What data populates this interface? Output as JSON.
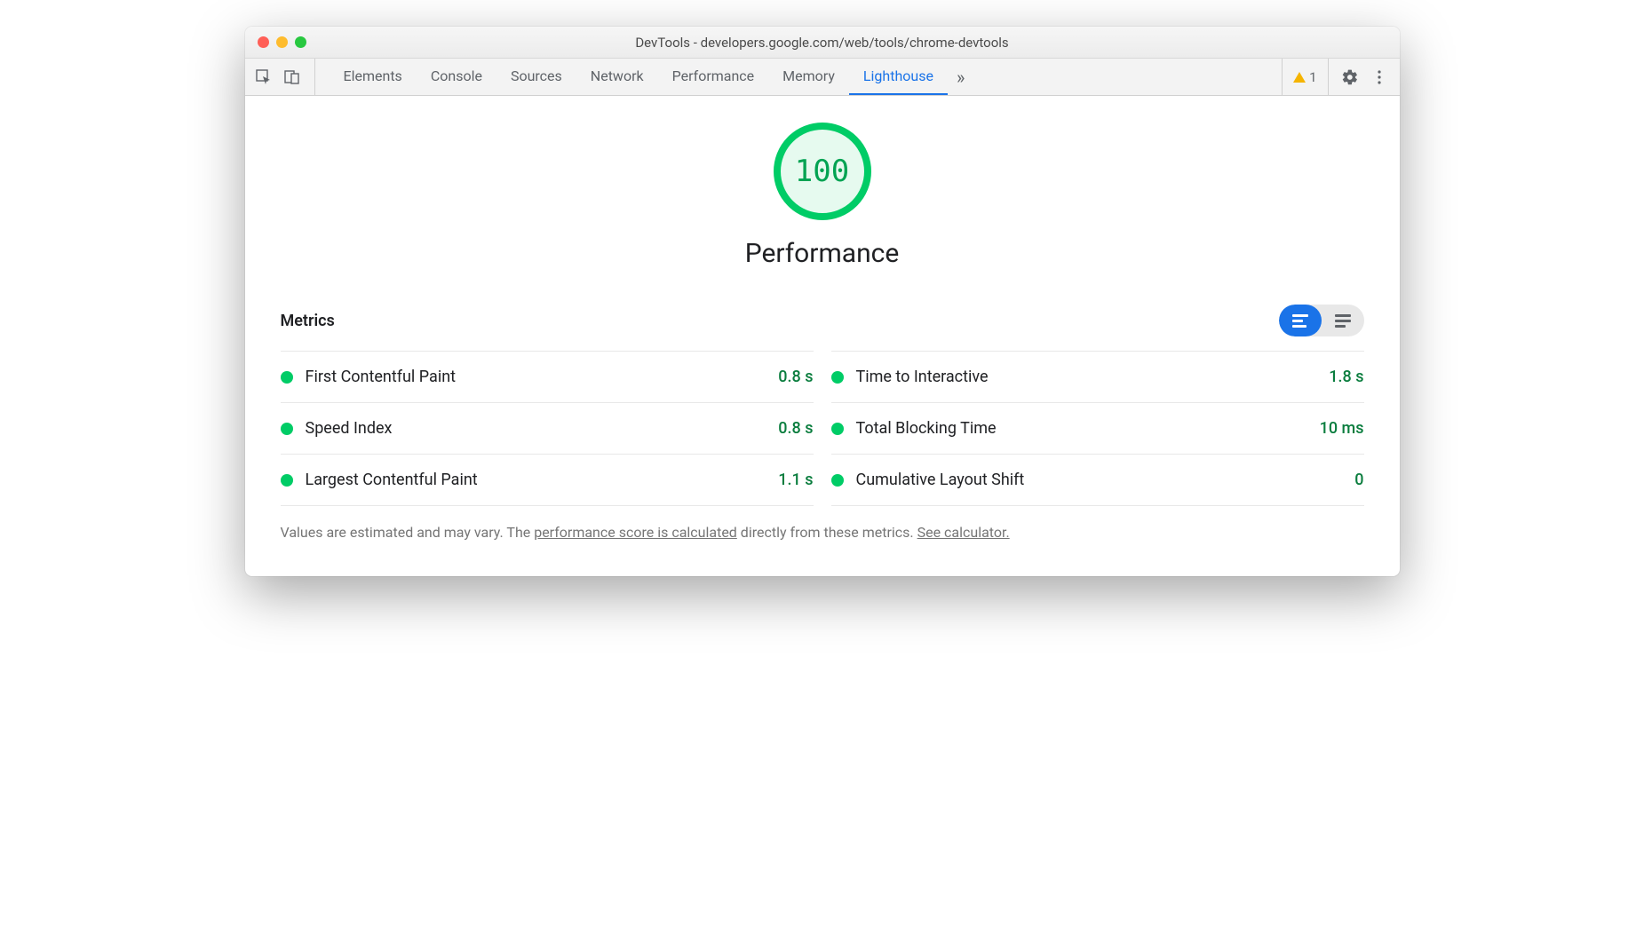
{
  "window": {
    "title": "DevTools - developers.google.com/web/tools/chrome-devtools"
  },
  "toolbar": {
    "tabs": [
      "Elements",
      "Console",
      "Sources",
      "Network",
      "Performance",
      "Memory",
      "Lighthouse"
    ],
    "active_tab_index": 6,
    "warnings_count": "1"
  },
  "score": {
    "value": "100",
    "category": "Performance"
  },
  "metrics": {
    "heading": "Metrics",
    "items": [
      {
        "name": "First Contentful Paint",
        "value": "0.8 s"
      },
      {
        "name": "Time to Interactive",
        "value": "1.8 s"
      },
      {
        "name": "Speed Index",
        "value": "0.8 s"
      },
      {
        "name": "Total Blocking Time",
        "value": "10 ms"
      },
      {
        "name": "Largest Contentful Paint",
        "value": "1.1 s"
      },
      {
        "name": "Cumulative Layout Shift",
        "value": "0"
      }
    ]
  },
  "footnote": {
    "prefix": "Values are estimated and may vary. The ",
    "link1": "performance score is calculated",
    "mid": " directly from these metrics. ",
    "link2": "See calculator."
  },
  "colors": {
    "good": "#00cc66",
    "accent": "#1a73e8"
  }
}
